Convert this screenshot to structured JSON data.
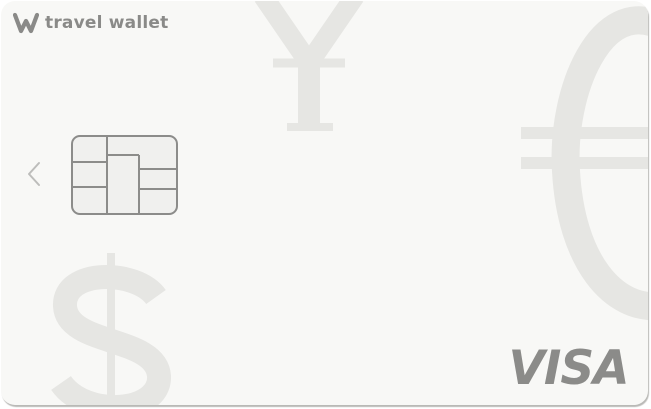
{
  "card": {
    "brand_name": "travel wallet",
    "network": "VISA",
    "prev_control": "chevron-left-icon",
    "watermark_symbols": [
      "¥",
      "€",
      "$"
    ]
  },
  "colors": {
    "card_background": "#f8f8f6",
    "brand_text": "#8a8a88",
    "watermark": "#e6e6e3",
    "chip_outline": "#8c8c8a",
    "network_logo": "#8b8b89"
  }
}
